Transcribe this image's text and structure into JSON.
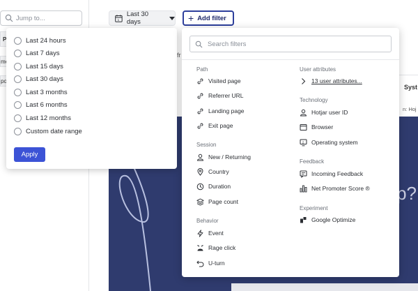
{
  "sidebar": {
    "jump_placeholder": "Jump to...",
    "tab_p": "P",
    "tab_me": "me",
    "tab_po": "po"
  },
  "toolbar": {
    "date_label": "Last 30 days",
    "add_filter_label": "Add filter"
  },
  "background": {
    "fr_text": "fr",
    "sys_text": "Syst",
    "n_text": "n: Hoj",
    "big_text": "p?"
  },
  "date_menu": {
    "options": [
      "Last 24 hours",
      "Last 7 days",
      "Last 15 days",
      "Last 30 days",
      "Last 3 months",
      "Last 6 months",
      "Last 12 months",
      "Custom date range"
    ],
    "apply_label": "Apply"
  },
  "filter_menu": {
    "search_placeholder": "Search filters",
    "path": {
      "heading": "Path",
      "items": [
        "Visited page",
        "Referrer URL",
        "Landing page",
        "Exit page"
      ]
    },
    "session": {
      "heading": "Session",
      "items": [
        "New / Returning",
        "Country",
        "Duration",
        "Page count"
      ]
    },
    "behavior": {
      "heading": "Behavior",
      "items": [
        "Event",
        "Rage click",
        "U-turn"
      ]
    },
    "user_attributes": {
      "heading": "User attributes",
      "items": [
        "13 user attributes..."
      ]
    },
    "technology": {
      "heading": "Technology",
      "items": [
        "Hotjar user ID",
        "Browser",
        "Operating system"
      ]
    },
    "feedback": {
      "heading": "Feedback",
      "items": [
        "Incoming Feedback",
        "Net Promoter Score ®"
      ]
    },
    "experiment": {
      "heading": "Experiment",
      "items": [
        "Google Optimize"
      ]
    }
  },
  "colors": {
    "accent": "#3c53d6",
    "add_filter_border": "#2d3f9c",
    "dark_bg": "#2f3b6e"
  }
}
